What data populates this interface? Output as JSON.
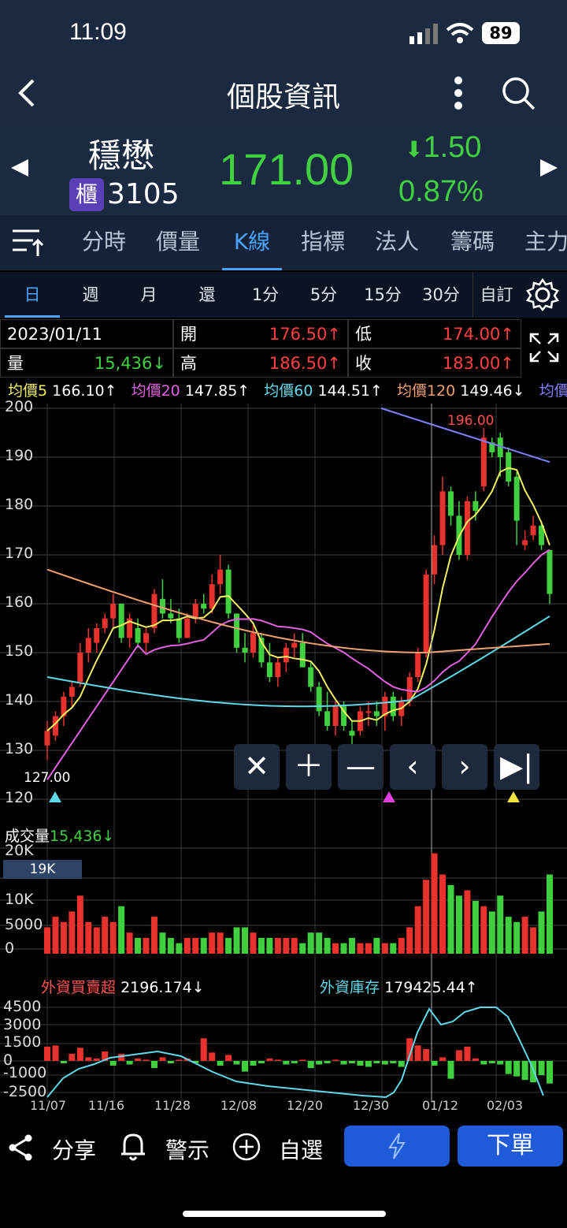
{
  "status": {
    "time": "11:09",
    "battery": "89"
  },
  "nav": {
    "title": "個股資訊"
  },
  "stock": {
    "name": "穩懋",
    "market_badge": "櫃",
    "code": "3105",
    "price": "171.00",
    "change": "1.50",
    "change_pct": "0.87%"
  },
  "tabs": [
    "分時",
    "價量",
    "K線",
    "指標",
    "法人",
    "籌碼",
    "主力"
  ],
  "periods": [
    "日",
    "週",
    "月",
    "還",
    "1分",
    "5分",
    "15分",
    "30分",
    "自訂"
  ],
  "info": {
    "date": "2023/01/11",
    "open_label": "開",
    "open": "176.50↑",
    "low_label": "低",
    "low": "174.00↑",
    "vol_label": "量",
    "vol": "15,436↓",
    "high_label": "高",
    "high": "186.50↑",
    "close_label": "收",
    "close": "183.00↑"
  },
  "ma": [
    {
      "label": "均價5",
      "value": "166.10↑",
      "color": "#f0f060"
    },
    {
      "label": "均價20",
      "value": "147.85↑",
      "color": "#e060e0"
    },
    {
      "label": "均價60",
      "value": "144.51↑",
      "color": "#60d8e8"
    },
    {
      "label": "均價120",
      "value": "149.46↓",
      "color": "#f0a070"
    },
    {
      "label": "均價",
      "value": "",
      "color": "#8080ff"
    }
  ],
  "price_axis": [
    "200",
    "190",
    "180",
    "170",
    "160",
    "150",
    "140",
    "130",
    "120"
  ],
  "price_marks": {
    "high_mark": "196.00",
    "low_mark": "127.00"
  },
  "volume": {
    "title": "成交量",
    "value": "15,436↓",
    "axis": [
      "20K",
      "10K",
      "5000",
      "0"
    ],
    "badge": "19K"
  },
  "foreign": {
    "net_label": "外資買賣超",
    "net_value": "2196.174↓",
    "hold_label": "外資庫存",
    "hold_value": "179425.44↑",
    "axis": [
      "4500",
      "3000",
      "1500",
      "0",
      "-1000",
      "-2500"
    ]
  },
  "x_dates": [
    "11/07",
    "11/16",
    "11/28",
    "12/08",
    "12/20",
    "12/30",
    "01/12",
    "02/03"
  ],
  "bottom": {
    "share": "分享",
    "alert": "警示",
    "watch": "自選",
    "order": "下單"
  },
  "colors": {
    "up": "#e8322e",
    "down": "#3fcf3f",
    "accent": "#4aa3ff",
    "header_bg": "#1c2a40"
  },
  "candles": [
    [
      131,
      136,
      128,
      134
    ],
    [
      133,
      138,
      132,
      137
    ],
    [
      137,
      142,
      135,
      141
    ],
    [
      141,
      144,
      139,
      143
    ],
    [
      144,
      152,
      143,
      150
    ],
    [
      150,
      155,
      148,
      153
    ],
    [
      152,
      156,
      150,
      155
    ],
    [
      155,
      158,
      154,
      157
    ],
    [
      157,
      162,
      155,
      160
    ],
    [
      160,
      160,
      152,
      153
    ],
    [
      153,
      158,
      151,
      157
    ],
    [
      155,
      157,
      151,
      152
    ],
    [
      152,
      155,
      150,
      154
    ],
    [
      155,
      163,
      154,
      162
    ],
    [
      161,
      165,
      157,
      158
    ],
    [
      158,
      161,
      156,
      157
    ],
    [
      157,
      159,
      152,
      153
    ],
    [
      153,
      158,
      153,
      157
    ],
    [
      157,
      161,
      156,
      160
    ],
    [
      160,
      162,
      158,
      159
    ],
    [
      159,
      166,
      158,
      164
    ],
    [
      164,
      170,
      162,
      167
    ],
    [
      167,
      168,
      157,
      158
    ],
    [
      158,
      158,
      150,
      151
    ],
    [
      151,
      154,
      148,
      150
    ],
    [
      150,
      156,
      149,
      154
    ],
    [
      153,
      154,
      147,
      148
    ],
    [
      148,
      152,
      144,
      145
    ],
    [
      145,
      149,
      143,
      148
    ],
    [
      148,
      152,
      146,
      151
    ],
    [
      151,
      154,
      149,
      152
    ],
    [
      152,
      154,
      147,
      147
    ],
    [
      147,
      148,
      142,
      143
    ],
    [
      143,
      144,
      137,
      138
    ],
    [
      138,
      142,
      134,
      135
    ],
    [
      135,
      140,
      133,
      139
    ],
    [
      139,
      140,
      134,
      135
    ],
    [
      134,
      136,
      131,
      133
    ],
    [
      134,
      139,
      133,
      138
    ],
    [
      138,
      140,
      135,
      138
    ],
    [
      138,
      140,
      135,
      137
    ],
    [
      137,
      142,
      134,
      141
    ],
    [
      141,
      142,
      136,
      137
    ],
    [
      137,
      141,
      135,
      140
    ],
    [
      140,
      146,
      139,
      145
    ],
    [
      145,
      151,
      144,
      150
    ],
    [
      150,
      167,
      149,
      166
    ],
    [
      166,
      174,
      164,
      172
    ],
    [
      172,
      186,
      170,
      183
    ],
    [
      183,
      184,
      176,
      178
    ],
    [
      178,
      181,
      169,
      170
    ],
    [
      170,
      182,
      169,
      181
    ],
    [
      181,
      183,
      177,
      179
    ],
    [
      184,
      196,
      183,
      194
    ],
    [
      193,
      194,
      190,
      191
    ],
    [
      194,
      195,
      186,
      190
    ],
    [
      191,
      192,
      184,
      185
    ],
    [
      186,
      187,
      172,
      177
    ],
    [
      172,
      175,
      171,
      173
    ],
    [
      174,
      178,
      173,
      176
    ],
    [
      176,
      177,
      171,
      172
    ],
    [
      171,
      171,
      160,
      162
    ]
  ],
  "vol_series": [
    5,
    7,
    6,
    8,
    11,
    6,
    5,
    7,
    6,
    9,
    4,
    3,
    3,
    7,
    4,
    3,
    2,
    3,
    3,
    3,
    4,
    4,
    3,
    5,
    5,
    4,
    3,
    3,
    3,
    3,
    3,
    2,
    4,
    4,
    3,
    2,
    2,
    3,
    2,
    2,
    3,
    2,
    2,
    3,
    5,
    9,
    14,
    19,
    15,
    13,
    11,
    12,
    10,
    9,
    8,
    11,
    7,
    6,
    7,
    5,
    8,
    15
  ],
  "foreign_net": [
    1200,
    1300,
    -200,
    600,
    1100,
    300,
    200,
    800,
    -400,
    600,
    -300,
    200,
    100,
    -600,
    300,
    -200,
    100,
    200,
    -200,
    1900,
    700,
    -400,
    500,
    -300,
    -900,
    -400,
    -200,
    200,
    100,
    -300,
    -200,
    100,
    -600,
    -300,
    -200,
    100,
    -300,
    -200,
    -400,
    -500,
    -200,
    -300,
    -200,
    -500,
    1900,
    1300,
    1000,
    -400,
    300,
    -1500,
    900,
    1200,
    200,
    -300,
    -200,
    -300,
    -1100,
    -1300,
    -1600,
    -1800,
    -1200,
    -1900
  ]
}
